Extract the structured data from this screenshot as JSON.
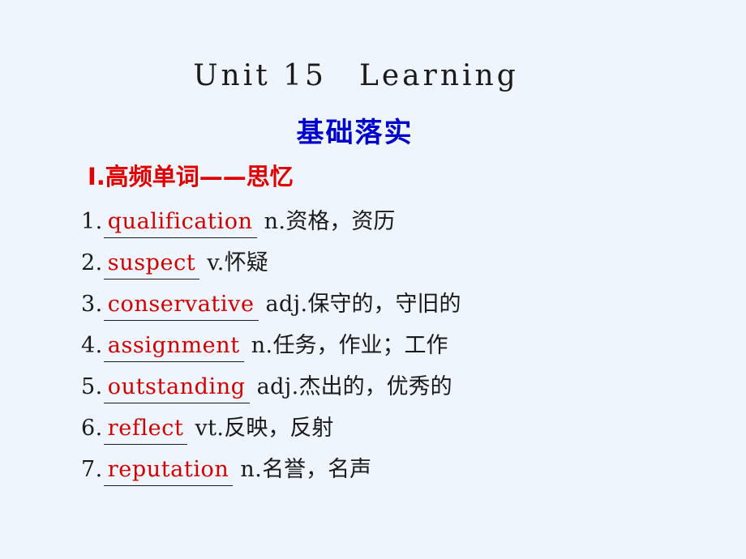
{
  "slide": {
    "background_color": "#eef5fc",
    "unit_title": "Unit 15　Learning",
    "sub_title": "基础落实",
    "section_heading": "Ⅰ.高频单词——思忆",
    "colors": {
      "heading_red": "#e00000",
      "term_red": "#d40000",
      "sub_title_blue": "#0000cc",
      "body_black": "#1a1a1a"
    }
  },
  "words": [
    {
      "num": "1.",
      "term": "qualification",
      "pos": "n.",
      "definition": "资格，资历"
    },
    {
      "num": "2.",
      "term": "suspect",
      "pos": "v.",
      "definition": "怀疑"
    },
    {
      "num": "3.",
      "term": "conservative",
      "pos": "adj.",
      "definition": "保守的，守旧的"
    },
    {
      "num": "4.",
      "term": "assignment",
      "pos": "n.",
      "definition": "任务，作业；工作"
    },
    {
      "num": "5.",
      "term": "outstanding",
      "pos": "adj.",
      "definition": "杰出的，优秀的"
    },
    {
      "num": "6.",
      "term": "reflect",
      "pos": "vt.",
      "definition": "反映，反射"
    },
    {
      "num": "7.",
      "term": "reputation",
      "pos": "n.",
      "definition": "名誉，名声"
    }
  ]
}
